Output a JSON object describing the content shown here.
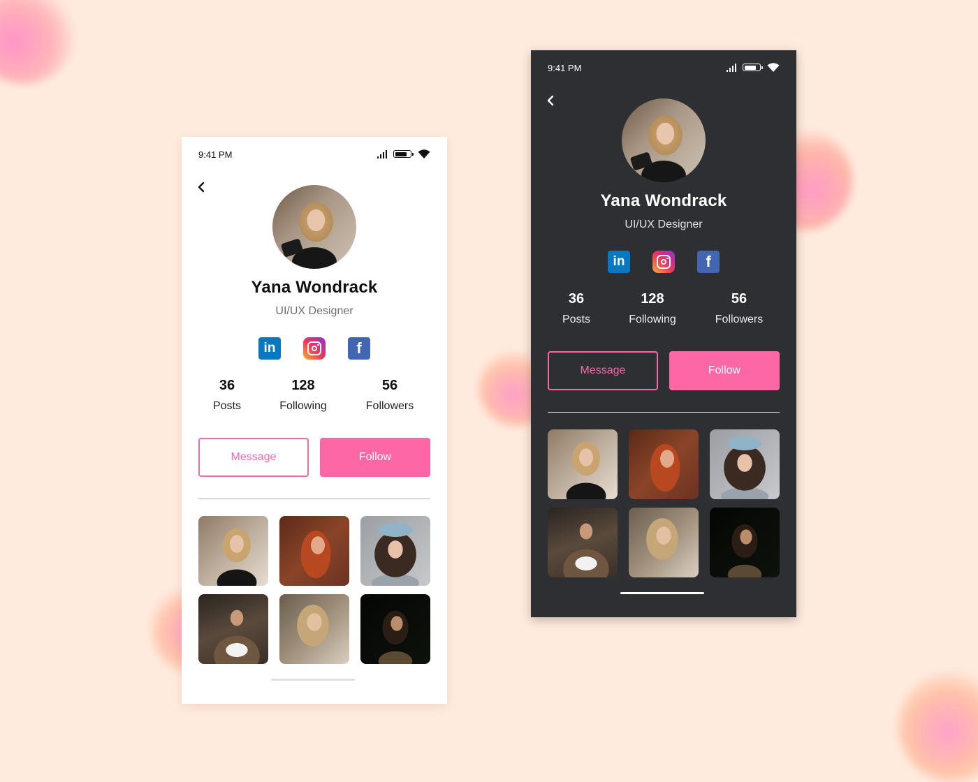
{
  "screens": {
    "light": {
      "status": {
        "time": "9:41 PM"
      },
      "profile": {
        "name": "Yana Wondrack",
        "role": "UI/UX Designer"
      },
      "socials": [
        "linkedin-icon",
        "instagram-icon",
        "facebook-icon"
      ],
      "stats": [
        {
          "value": "36",
          "label": "Posts"
        },
        {
          "value": "128",
          "label": "Following"
        },
        {
          "value": "56",
          "label": "Followers"
        }
      ],
      "buttons": {
        "message": "Message",
        "follow": "Follow"
      }
    },
    "dark": {
      "status": {
        "time": "9:41 PM"
      },
      "profile": {
        "name": "Yana Wondrack",
        "role": "UI/UX Designer"
      },
      "socials": [
        "linkedin-icon",
        "instagram-icon",
        "facebook-icon"
      ],
      "stats": [
        {
          "value": "36",
          "label": "Posts"
        },
        {
          "value": "128",
          "label": "Following"
        },
        {
          "value": "56",
          "label": "Followers"
        }
      ],
      "buttons": {
        "message": "Message",
        "follow": "Follow"
      }
    }
  },
  "icons": {
    "linkedin": "in",
    "facebook": "f"
  },
  "colors": {
    "background": "#ffebde",
    "accent_pink": "#fd67a6",
    "dark_surface": "#2d2f33",
    "light_surface": "#ffffff",
    "linkedin_blue": "#0a78c0",
    "facebook_blue": "#4267b2"
  }
}
